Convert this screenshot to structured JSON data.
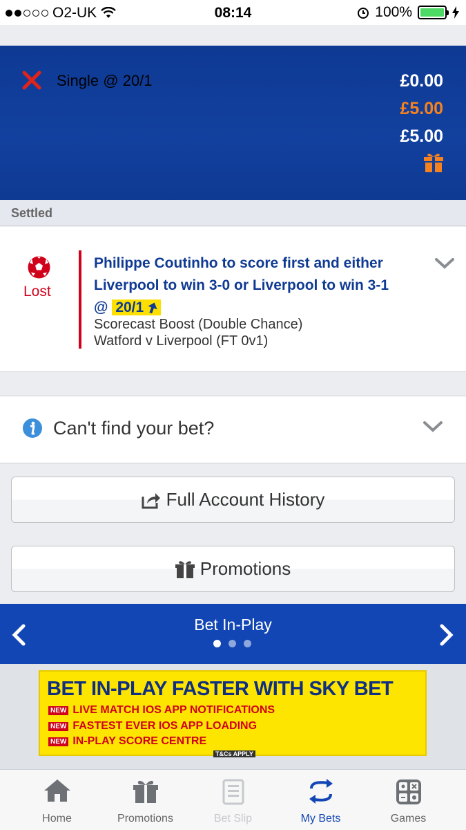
{
  "status_bar": {
    "carrier": "O2-UK",
    "time": "08:14",
    "battery": "100%"
  },
  "bet": {
    "type": "Single @ 20/1",
    "returns": "£0.00",
    "stake": "£5.00",
    "total_stake": "£5.00",
    "settled_label": "Settled",
    "result": "Lost",
    "selection": "Philippe Coutinho to score first and either Liverpool to win 3-0 or Liverpool to win 3-1",
    "odds_prefix": "@",
    "odds": "20/1",
    "market": "Scorecast Boost (Double Chance)",
    "event": "Watford v Liverpool (FT 0v1)"
  },
  "cant_find": {
    "label": "Can't find your bet?"
  },
  "buttons": {
    "history": "Full Account History",
    "promotions": "Promotions"
  },
  "inplay": {
    "title": "Bet In-Play",
    "pages": 3,
    "current_page": 1
  },
  "banner": {
    "title": "BET IN-PLAY FASTER WITH SKY BET",
    "new_badge": "NEW",
    "lines": [
      "LIVE MATCH IOS APP NOTIFICATIONS",
      "FASTEST EVER IOS APP LOADING",
      "IN-PLAY SCORE CENTRE"
    ],
    "tcs": "T&Cs APPLY"
  },
  "tabs": [
    {
      "label": "Home",
      "icon": "home-icon"
    },
    {
      "label": "Promotions",
      "icon": "gift-icon"
    },
    {
      "label": "Bet Slip",
      "icon": "betslip-icon"
    },
    {
      "label": "My Bets",
      "icon": "mybets-icon"
    },
    {
      "label": "Games",
      "icon": "games-icon"
    }
  ],
  "colors": {
    "brand_blue": "#0f3a93",
    "lost_red": "#d0021b",
    "stake_orange": "#f5821f",
    "highlight_yellow": "#fde000"
  }
}
